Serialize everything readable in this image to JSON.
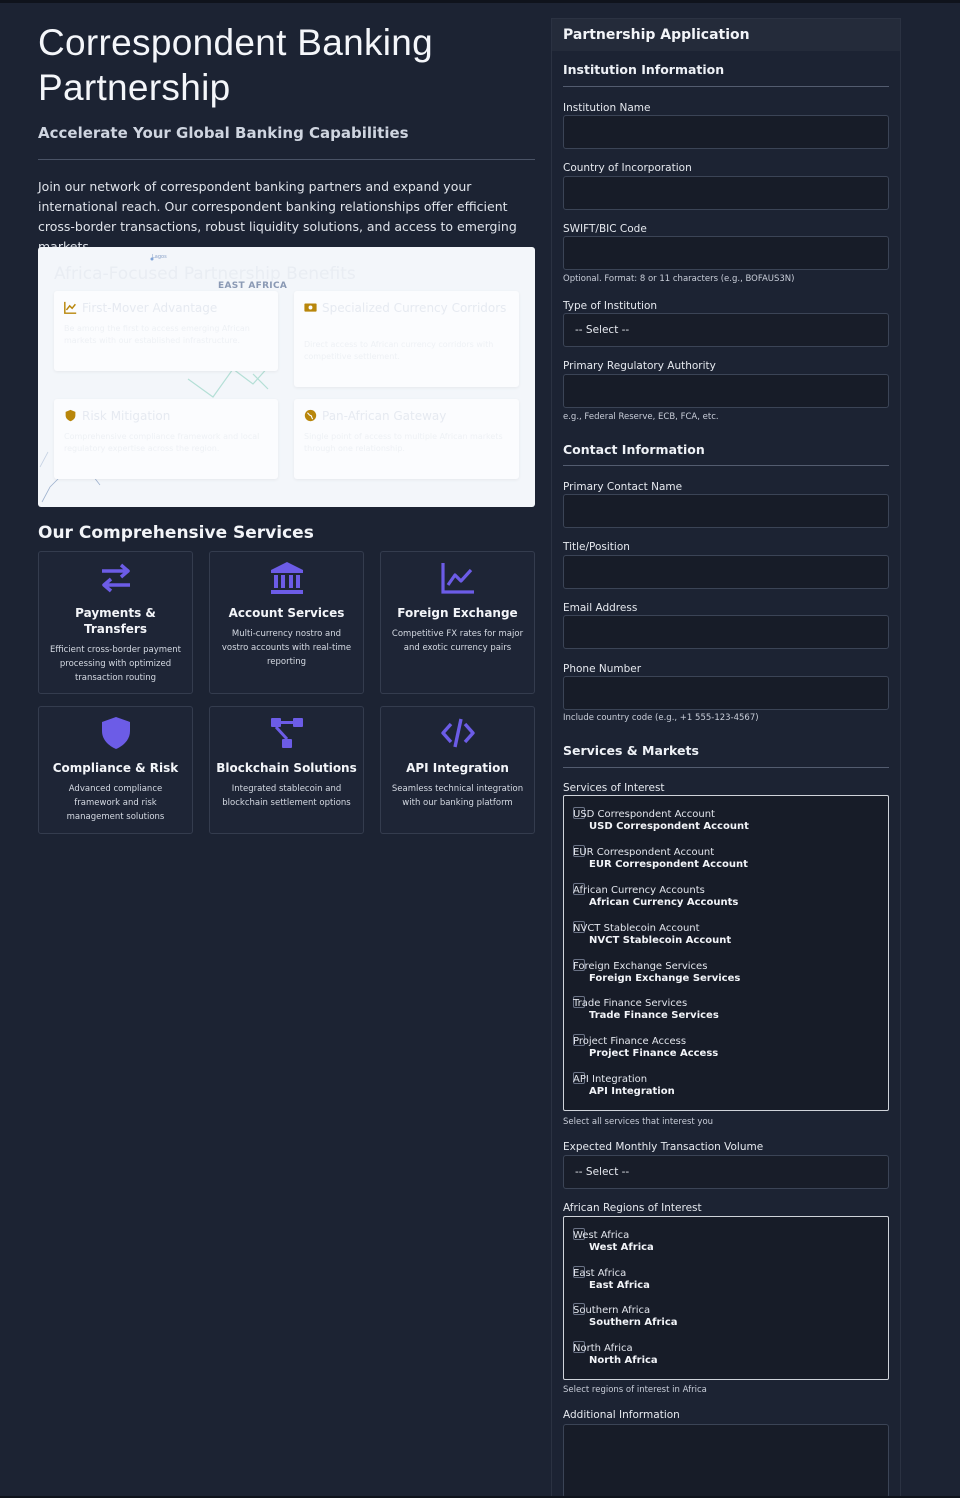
{
  "hero": {
    "title": "Correspondent Banking Partnership",
    "subtitle": "Accelerate Your Global Banking Capabilities",
    "intro": "Join our network of correspondent banking partners and expand your international reach. Our correspondent banking relationships offer efficient cross-border transactions, robust liquidity solutions, and access to emerging markets."
  },
  "map": {
    "title": "Africa-Focused Partnership Benefits",
    "region_label": "EAST AFRICA",
    "city_label": "Lagos",
    "cards": [
      {
        "icon": "chart-line-icon",
        "title": "First-Mover Advantage",
        "desc": "Be among the first to access emerging African markets with our established infrastructure."
      },
      {
        "icon": "money-bill-icon",
        "title": "Specialized Currency Corridors",
        "desc": "Direct access to African currency corridors with competitive settlement."
      },
      {
        "icon": "shield-icon",
        "title": "Risk Mitigation",
        "desc": "Comprehensive compliance framework and local regulatory expertise across the region."
      },
      {
        "icon": "globe-icon",
        "title": "Pan-African Gateway",
        "desc": "Single point of access to multiple African markets through one relationship."
      }
    ]
  },
  "services": {
    "heading": "Our Comprehensive Services",
    "items": [
      {
        "icon": "transfer-arrows-icon",
        "title": "Payments & Transfers",
        "desc": "Efficient cross-border payment processing with optimized transaction routing"
      },
      {
        "icon": "bank-building-icon",
        "title": "Account Services",
        "desc": "Multi-currency nostro and vostro accounts with real-time reporting"
      },
      {
        "icon": "chart-line-icon",
        "title": "Foreign Exchange",
        "desc": "Competitive FX rates for major and exotic currency pairs"
      },
      {
        "icon": "shield-icon",
        "title": "Compliance & Risk",
        "desc": "Advanced compliance framework and risk management solutions"
      },
      {
        "icon": "network-nodes-icon",
        "title": "Blockchain Solutions",
        "desc": "Integrated stablecoin and blockchain settlement options"
      },
      {
        "icon": "code-brackets-icon",
        "title": "API Integration",
        "desc": "Seamless technical integration with our banking platform"
      }
    ]
  },
  "form": {
    "title": "Partnership Application",
    "sections": {
      "institution": "Institution Information",
      "contact": "Contact Information",
      "services": "Services & Markets"
    },
    "fields": {
      "institution_name": "Institution Name",
      "country": "Country of Incorporation",
      "swift": "SWIFT/BIC Code",
      "swift_hint": "Optional. Format: 8 or 11 characters (e.g., BOFAUS3N)",
      "type": "Type of Institution",
      "type_value": "-- Select --",
      "regulator": "Primary Regulatory Authority",
      "regulator_hint": "e.g., Federal Reserve, ECB, FCA, etc.",
      "contact_name": "Primary Contact Name",
      "position": "Title/Position",
      "email": "Email Address",
      "phone": "Phone Number",
      "phone_hint": "Include country code (e.g., +1 555-123-4567)",
      "services_label": "Services of Interest",
      "services_hint": "Select all services that interest you",
      "volume": "Expected Monthly Transaction Volume",
      "volume_value": "-- Select --",
      "regions_label": "African Regions of Interest",
      "regions_hint": "Select regions of interest in Africa",
      "additional": "Additional Information"
    },
    "service_options": [
      "USD Correspondent Account",
      "EUR Correspondent Account",
      "African Currency Accounts",
      "NVCT Stablecoin Account",
      "Foreign Exchange Services",
      "Trade Finance Services",
      "Project Finance Access",
      "API Integration"
    ],
    "region_options": [
      "West Africa",
      "East Africa",
      "Southern Africa",
      "North Africa"
    ]
  },
  "colors": {
    "background": "#1c2333",
    "accent": "#6c5ce7",
    "benefit_icon": "#b8860b"
  }
}
